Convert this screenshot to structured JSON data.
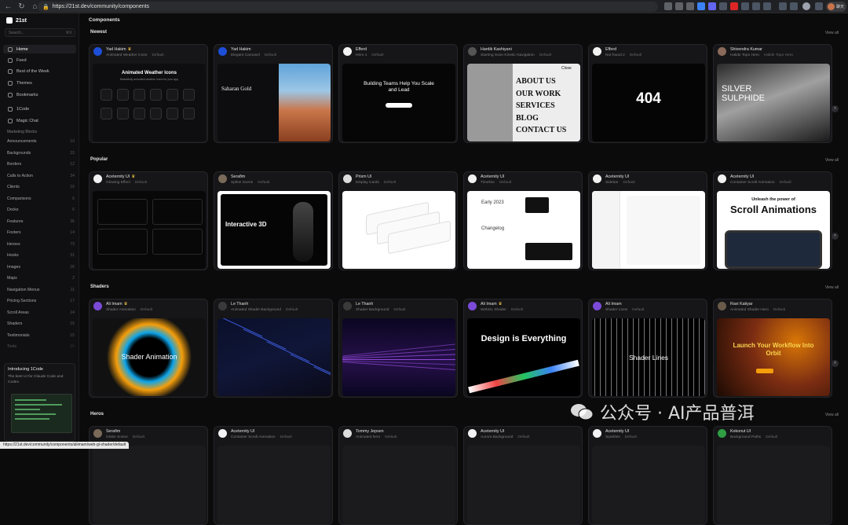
{
  "browser": {
    "url": "https://21st.dev/community/components",
    "profile_label": "聊天"
  },
  "sidebar": {
    "brand": "21st",
    "search_placeholder": "Search...",
    "search_kbd": "⌘K",
    "nav": [
      {
        "label": "Home",
        "icon": "home-icon",
        "active": true
      },
      {
        "label": "Feed",
        "icon": "feed-icon"
      },
      {
        "label": "Best of the Week",
        "icon": "trophy-icon"
      },
      {
        "label": "Themes",
        "icon": "palette-icon"
      },
      {
        "label": "Bookmarks",
        "icon": "bookmark-icon"
      },
      {
        "label": "1Code",
        "icon": "code-icon"
      },
      {
        "label": "Magic Chat",
        "icon": "sparkle-icon"
      }
    ],
    "section_label": "Marketing Blocks",
    "categories": [
      {
        "label": "Announcements",
        "count": "10"
      },
      {
        "label": "Backgrounds",
        "count": "33"
      },
      {
        "label": "Borders",
        "count": "12"
      },
      {
        "label": "Calls to Action",
        "count": "34"
      },
      {
        "label": "Clients",
        "count": "16"
      },
      {
        "label": "Comparisons",
        "count": "6"
      },
      {
        "label": "Docks",
        "count": "6"
      },
      {
        "label": "Features",
        "count": "36"
      },
      {
        "label": "Footers",
        "count": "14"
      },
      {
        "label": "Heroes",
        "count": "73"
      },
      {
        "label": "Hooks",
        "count": "31"
      },
      {
        "label": "Images",
        "count": "26"
      },
      {
        "label": "Maps",
        "count": "2"
      },
      {
        "label": "Navigation Menus",
        "count": "11"
      },
      {
        "label": "Pricing Sections",
        "count": "17"
      },
      {
        "label": "Scroll Areas",
        "count": "24"
      },
      {
        "label": "Shaders",
        "count": "15"
      },
      {
        "label": "Testimonials",
        "count": "15"
      },
      {
        "label": "Texts",
        "count": "58"
      }
    ],
    "promo": {
      "title": "Introducing 1Code",
      "desc": "The best UI for Claude Code and Codex."
    }
  },
  "main": {
    "page_title": "Components",
    "view_all": "View all",
    "sections": [
      {
        "title": "Newest",
        "cards": [
          {
            "author": "Yad Hakim",
            "name": "Animated Weather Icons",
            "variant": "Default",
            "avatar_color": "#1d4ed8",
            "pro": true
          },
          {
            "author": "Yad Hakim",
            "name": "Elegant Carousel",
            "variant": "Default",
            "avatar_color": "#1d4ed8",
            "pro": false
          },
          {
            "author": "Efferd",
            "name": "Hero 1",
            "variant": "Default",
            "avatar_color": "#f2f2f2",
            "pro": false
          },
          {
            "author": "Hardik Kashiyani",
            "name": "Starting Soon Kinetic Navigation",
            "variant": "Default",
            "avatar_color": "#555555",
            "pro": false
          },
          {
            "author": "Efferd",
            "name": "Not found 2",
            "variant": "Default",
            "avatar_color": "#f2f2f2",
            "pro": false
          },
          {
            "author": "Shivendra Kumar",
            "name": "Halide Topo Hero",
            "variant": "Halide Topo Hero",
            "avatar_color": "#8a6a5a",
            "pro": false
          }
        ]
      },
      {
        "title": "Popular",
        "cards": [
          {
            "author": "Aceternity UI",
            "name": "Glowing Effect",
            "variant": "Default",
            "avatar_color": "#f2f2f2",
            "pro": true
          },
          {
            "author": "Serafim",
            "name": "Spline Scene",
            "variant": "Default",
            "avatar_color": "#7a6a5a",
            "pro": false
          },
          {
            "author": "Prism UI",
            "name": "Display Cards",
            "variant": "Default",
            "avatar_color": "#dcdcdc",
            "pro": false
          },
          {
            "author": "Aceternity UI",
            "name": "Timeline",
            "variant": "Default",
            "avatar_color": "#f2f2f2",
            "pro": false
          },
          {
            "author": "Aceternity UI",
            "name": "Sidebar",
            "variant": "Default",
            "avatar_color": "#f2f2f2",
            "pro": false
          },
          {
            "author": "Aceternity UI",
            "name": "Container Scroll Animation",
            "variant": "Default",
            "avatar_color": "#f2f2f2",
            "pro": false
          }
        ]
      },
      {
        "title": "Shaders",
        "cards": [
          {
            "author": "Ali Imam",
            "name": "Shader Animation",
            "variant": "Default",
            "avatar_color": "#7b4bd8",
            "pro": true
          },
          {
            "author": "Le Thanh",
            "name": "Animated Shader Background",
            "variant": "Default",
            "avatar_color": "#3a3a3a",
            "pro": false
          },
          {
            "author": "Le Thanh",
            "name": "Shader Background",
            "variant": "Default",
            "avatar_color": "#3a3a3a",
            "pro": false
          },
          {
            "author": "Ali Imam",
            "name": "WebGL Shader",
            "variant": "Default",
            "avatar_color": "#7b4bd8",
            "pro": true
          },
          {
            "author": "Ali Imam",
            "name": "Shader Lines",
            "variant": "Default",
            "avatar_color": "#7b4bd8",
            "pro": false
          },
          {
            "author": "Ravi Katiyar",
            "name": "Animated Shader Hero",
            "variant": "Default",
            "avatar_color": "#6a5a4a",
            "pro": false
          }
        ]
      },
      {
        "title": "Heros",
        "cards": [
          {
            "author": "Serafim",
            "name": "Globe Scene",
            "variant": "Default",
            "avatar_color": "#7a6a5a",
            "pro": false
          },
          {
            "author": "Aceternity UI",
            "name": "Container Scroll Animation",
            "variant": "Default",
            "avatar_color": "#f2f2f2",
            "pro": false
          },
          {
            "author": "Tommy Jepsen",
            "name": "Animated hero",
            "variant": "Default",
            "avatar_color": "#dcdcdc",
            "pro": false
          },
          {
            "author": "Aceternity UI",
            "name": "Aurora Background",
            "variant": "Default",
            "avatar_color": "#f2f2f2",
            "pro": false
          },
          {
            "author": "Aceternity UI",
            "name": "Sparkles",
            "variant": "Default",
            "avatar_color": "#f2f2f2",
            "pro": false
          },
          {
            "author": "Kokonut UI",
            "name": "Background Paths",
            "variant": "Default",
            "avatar_color": "#2f9e44",
            "pro": false
          }
        ]
      }
    ],
    "previews": {
      "weather_title": "Animated Weather Icons",
      "weather_sub": "Beautifully animated weather icons for your app",
      "saharan": "Saharan Gold",
      "hero1_title": "Building Teams Help You Scale and Lead",
      "menu_items": [
        "ABOUT US",
        "OUR WORK",
        "SERVICES",
        "BLOG",
        "CONTACT US"
      ],
      "menu_close": "Close",
      "nf_code": "404",
      "silver": "SILVER SULPHIDE",
      "spline_title": "Interactive 3D",
      "timeline_year": "Early 2023",
      "timeline_changelog": "Changelog",
      "scroll_title_1": "Unleash the power of",
      "scroll_title_2": "Scroll Animations",
      "shader_anim": "Shader Animation",
      "design_everything": "Design is Everything",
      "shader_lines": "Shader Lines",
      "orbit": "Launch Your Workflow Into Orbit"
    }
  },
  "status_bar": "https://21st.dev/community/components/aliimam/web-gl-shader/default",
  "watermark": "公众号 · AI产品普洱"
}
